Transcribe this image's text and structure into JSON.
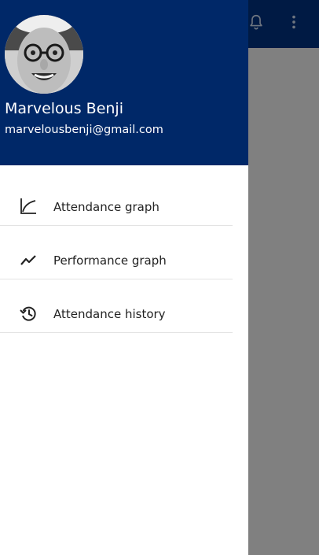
{
  "app": {
    "toolbar_icons": [
      "notification-bell-icon",
      "more-vertical-icon"
    ]
  },
  "drawer": {
    "user": {
      "name": "Marvelous Benji",
      "email": "marvelousbenji@gmail.com"
    },
    "menu": [
      {
        "label": "Attendance graph",
        "icon": "line-chart-icon"
      },
      {
        "label": "Performance graph",
        "icon": "trending-up-icon"
      },
      {
        "label": "Attendance history",
        "icon": "history-icon"
      }
    ]
  },
  "colors": {
    "drawer_header": "#002868",
    "toolbar": "#001a44",
    "scrim": "#808080",
    "text": "#222222"
  }
}
